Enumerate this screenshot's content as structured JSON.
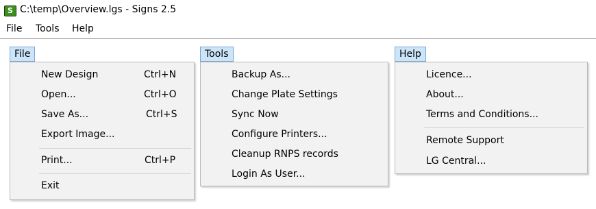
{
  "window": {
    "icon_letter": "S",
    "icon_name": "signs-app-icon",
    "title": "C:\\temp\\Overview.lgs - Signs 2.5"
  },
  "menubar": {
    "file": "File",
    "tools": "Tools",
    "help": "Help"
  },
  "file_menu": {
    "header": "File",
    "new_design": "New Design",
    "new_design_shortcut": "Ctrl+N",
    "open": "Open...",
    "open_shortcut": "Ctrl+O",
    "save_as": "Save As...",
    "save_as_shortcut": "Ctrl+S",
    "export_image": "Export Image...",
    "print": "Print...",
    "print_shortcut": "Ctrl+P",
    "exit": "Exit"
  },
  "tools_menu": {
    "header": "Tools",
    "backup_as": "Backup As...",
    "change_plate_settings": "Change Plate Settings",
    "sync_now": "Sync Now",
    "configure_printers": "Configure Printers...",
    "cleanup_rnps": "Cleanup RNPS records",
    "login_as_user": "Login As User..."
  },
  "help_menu": {
    "header": "Help",
    "licence": "Licence...",
    "about": "About...",
    "terms": "Terms and Conditions...",
    "remote_support": "Remote Support",
    "lg_central": "LG Central..."
  },
  "colors": {
    "header_highlight": "#cce4f7",
    "header_border": "#7aa7d3",
    "menu_background": "#f2f2f2",
    "icon_green": "#3c8d1f"
  }
}
